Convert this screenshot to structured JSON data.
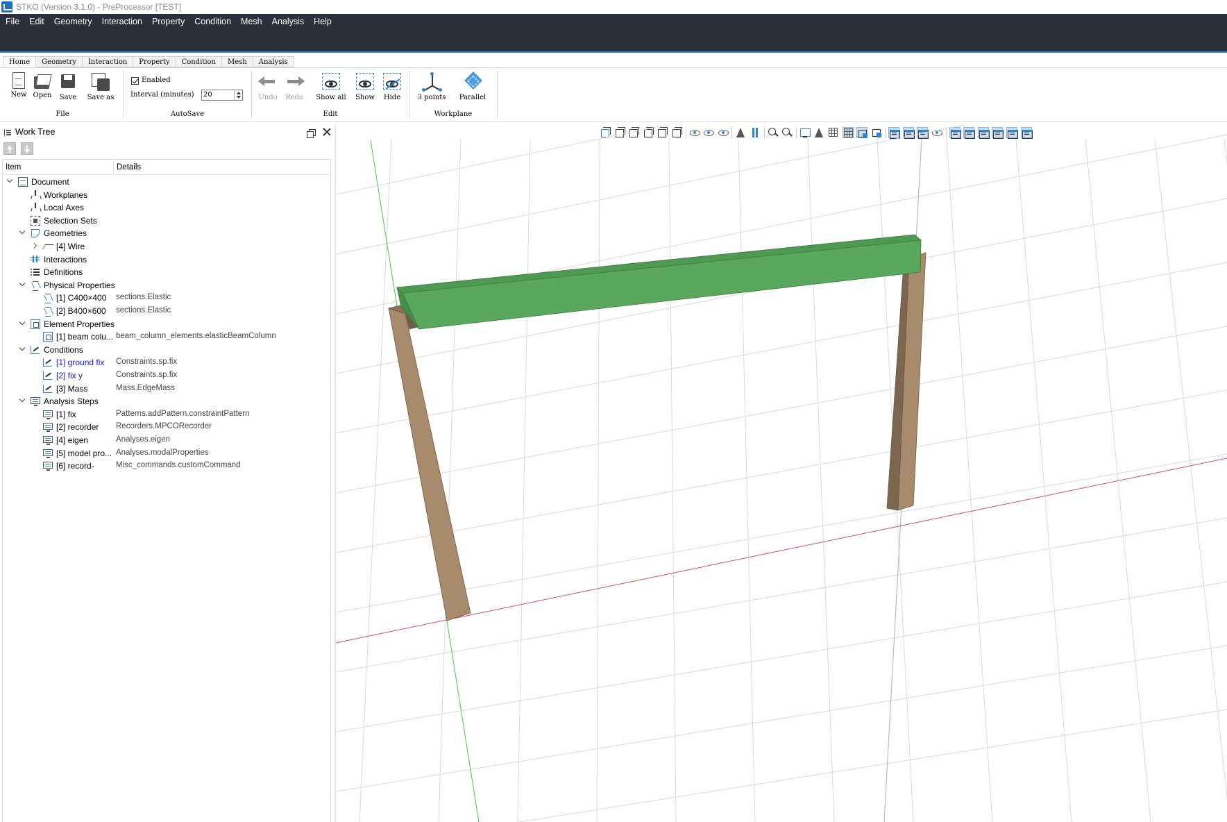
{
  "window": {
    "title": "STKO (Version 3.1.0) - PreProcessor [TEST]"
  },
  "menu": [
    "File",
    "Edit",
    "Geometry",
    "Interaction",
    "Property",
    "Condition",
    "Mesh",
    "Analysis",
    "Help"
  ],
  "ribbon": {
    "tabs": [
      "Home",
      "Geometry",
      "Interaction",
      "Property",
      "Condition",
      "Mesh",
      "Analysis"
    ],
    "active_tab": "Home",
    "file": {
      "title": "File",
      "new": "New",
      "open": "Open",
      "save": "Save",
      "save_as": "Save as"
    },
    "autosave": {
      "title": "AutoSave",
      "enabled_label": "Enabled",
      "enabled": true,
      "interval_label": "Interval (minutes)",
      "interval_value": "20"
    },
    "edit": {
      "title": "Edit",
      "undo": "Undo",
      "redo": "Redo",
      "show_all": "Show all",
      "show": "Show",
      "hide": "Hide"
    },
    "workplane": {
      "title": "Workplane",
      "three_points": "3 points",
      "parallel": "Parallel"
    }
  },
  "work_tree": {
    "title": "Work Tree",
    "columns": {
      "item": "Item",
      "details": "Details"
    },
    "rows": [
      {
        "name": "Document",
        "detail": "",
        "level": 0,
        "expand": "down",
        "icon": "document-icon"
      },
      {
        "name": "Workplanes",
        "detail": "",
        "level": 1,
        "expand": "",
        "icon": "workplane-icon"
      },
      {
        "name": "Local Axes",
        "detail": "",
        "level": 1,
        "expand": "",
        "icon": "local-axes-icon"
      },
      {
        "name": "Selection Sets",
        "detail": "",
        "level": 1,
        "expand": "",
        "icon": "selection-set-icon"
      },
      {
        "name": "Geometries",
        "detail": "",
        "level": 1,
        "expand": "down",
        "icon": "geometry-icon"
      },
      {
        "name": "[4] Wire",
        "detail": "",
        "level": 2,
        "expand": "right",
        "icon": "wire-icon"
      },
      {
        "name": "Interactions",
        "detail": "",
        "level": 1,
        "expand": "",
        "icon": "interaction-icon"
      },
      {
        "name": "Definitions",
        "detail": "",
        "level": 1,
        "expand": "",
        "icon": "definitions-icon"
      },
      {
        "name": "Physical Properties",
        "detail": "",
        "level": 1,
        "expand": "down",
        "icon": "physical-property-icon"
      },
      {
        "name": "[1] C400×400",
        "detail": "sections.Elastic",
        "level": 2,
        "expand": "",
        "icon": "physical-property-icon"
      },
      {
        "name": "[2] B400×600",
        "detail": "sections.Elastic",
        "level": 2,
        "expand": "",
        "icon": "physical-property-icon"
      },
      {
        "name": "Element Properties",
        "detail": "",
        "level": 1,
        "expand": "down",
        "icon": "element-property-icon"
      },
      {
        "name": "[1] beam colu...",
        "detail": "beam_column_elements.elasticBeamColumn",
        "level": 2,
        "expand": "",
        "icon": "element-property-icon"
      },
      {
        "name": "Conditions",
        "detail": "",
        "level": 1,
        "expand": "down",
        "icon": "condition-icon"
      },
      {
        "name": "[1] ground fix",
        "detail": "Constraints.sp.fix",
        "level": 2,
        "expand": "",
        "icon": "condition-icon",
        "highlight": true
      },
      {
        "name": "[2] fix y",
        "detail": "Constraints.sp.fix",
        "level": 2,
        "expand": "",
        "icon": "condition-icon",
        "highlight": true
      },
      {
        "name": "[3] Mass",
        "detail": "Mass.EdgeMass",
        "level": 2,
        "expand": "",
        "icon": "condition-icon"
      },
      {
        "name": "Analysis Steps",
        "detail": "",
        "level": 1,
        "expand": "down",
        "icon": "analysis-step-icon"
      },
      {
        "name": "[1] fix",
        "detail": "Patterns.addPattern.constraintPattern",
        "level": 2,
        "expand": "",
        "icon": "analysis-step-icon"
      },
      {
        "name": "[2] recorder",
        "detail": "Recorders.MPCORecorder",
        "level": 2,
        "expand": "",
        "icon": "analysis-step-icon"
      },
      {
        "name": "[4] eigen",
        "detail": "Analyses.eigen",
        "level": 2,
        "expand": "",
        "icon": "analysis-step-icon"
      },
      {
        "name": "[5] model pro...",
        "detail": "Analyses.modalProperties",
        "level": 2,
        "expand": "",
        "icon": "analysis-step-icon"
      },
      {
        "name": "[6] record-",
        "detail": "Misc_commands.customCommand",
        "level": 2,
        "expand": "",
        "icon": "analysis-step-icon"
      }
    ]
  },
  "viewport": {
    "toolbar_icons": [
      "iso-view-icon",
      "front-view-icon",
      "back-view-icon",
      "left-view-icon",
      "right-view-icon",
      "top-view-icon",
      "sep",
      "show-hidden-icon",
      "eye-icon",
      "hide-eye-icon",
      "sep",
      "mirror-icon",
      "pause-bars-icon",
      "sep",
      "zoom-fit-icon",
      "zoom-icon",
      "sep",
      "screenshot-icon",
      "measure-icon",
      "grid-icon",
      "grid-selected-icon",
      "bounding-box-icon",
      "layout-icon",
      "sep",
      "layer-icon",
      "layer-icon",
      "layer-icon",
      "axes-icon",
      "sep",
      "panel-icon",
      "panel-icon",
      "panel-icon",
      "panel-icon",
      "panel-icon",
      "panel-icon"
    ],
    "colors": {
      "beam": "#5aa85e",
      "column": "#a88b6c",
      "grid": "#d9d9d9",
      "x_axis": "#d94f4f",
      "y_axis": "#4fc34f",
      "z_axis": "#b0b0b0"
    }
  },
  "colors": {
    "menubar_bg": "#2a2f3a",
    "accent": "#3a87d9",
    "tree_highlight": "#1414d6"
  }
}
